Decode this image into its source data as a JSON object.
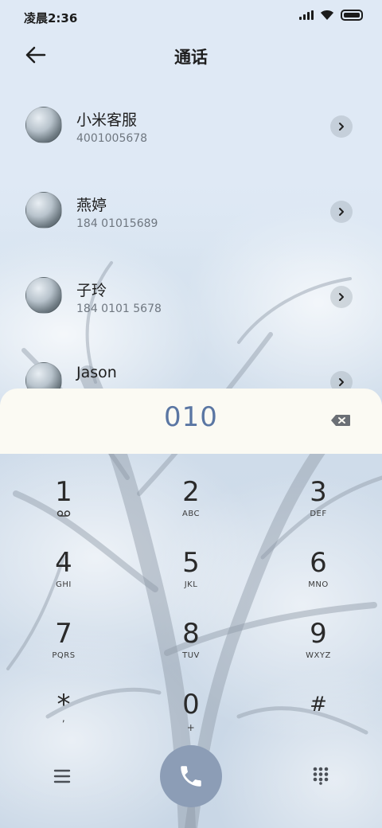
{
  "status_bar": {
    "time": "凌晨2:36",
    "icons": [
      "signal-icon",
      "wifi-icon",
      "battery-icon"
    ]
  },
  "header": {
    "back_icon": "arrow-left-icon",
    "title": "通话"
  },
  "contacts": [
    {
      "name": "小米客服",
      "number": "4001005678"
    },
    {
      "name": "燕婷",
      "number": "184 01015689"
    },
    {
      "name": "子玲",
      "number": "184 0101 5678"
    },
    {
      "name": "Jason",
      "number": ""
    }
  ],
  "dialer": {
    "dialed_number": "010",
    "backspace_icon": "backspace-icon",
    "keys": [
      {
        "digit": "1",
        "letters": "",
        "icon": "voicemail-icon"
      },
      {
        "digit": "2",
        "letters": "ABC"
      },
      {
        "digit": "3",
        "letters": "DEF"
      },
      {
        "digit": "4",
        "letters": "GHI"
      },
      {
        "digit": "5",
        "letters": "JKL"
      },
      {
        "digit": "6",
        "letters": "MNO"
      },
      {
        "digit": "7",
        "letters": "PQRS"
      },
      {
        "digit": "8",
        "letters": "TUV"
      },
      {
        "digit": "9",
        "letters": "WXYZ"
      },
      {
        "digit": "*",
        "letters": ","
      },
      {
        "digit": "0",
        "letters": "+"
      },
      {
        "digit": "#",
        "letters": ""
      }
    ]
  },
  "bottom_bar": {
    "menu_icon": "menu-icon",
    "call_icon": "phone-icon",
    "keypad_icon": "dialpad-icon"
  },
  "colors": {
    "accent": "#5a76a3",
    "call_button": "#8c9db6",
    "dial_panel": "#fbfaf3"
  }
}
